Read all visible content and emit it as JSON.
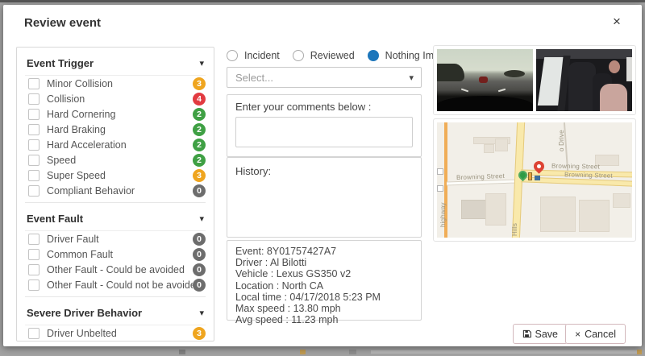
{
  "modal": {
    "title": "Review event"
  },
  "icons": {
    "close": "×",
    "caret_down": "▾",
    "select_caret": "▾",
    "cancel_x": "×"
  },
  "left_panel": {
    "sections": [
      {
        "title": "Event Trigger",
        "items": [
          {
            "label": "Minor Collision",
            "count": "3",
            "color": "amber"
          },
          {
            "label": "Collision",
            "count": "4",
            "color": "red"
          },
          {
            "label": "Hard Cornering",
            "count": "2",
            "color": "green"
          },
          {
            "label": "Hard Braking",
            "count": "2",
            "color": "green"
          },
          {
            "label": "Hard Acceleration",
            "count": "2",
            "color": "green"
          },
          {
            "label": "Speed",
            "count": "2",
            "color": "green"
          },
          {
            "label": "Super Speed",
            "count": "3",
            "color": "amber"
          },
          {
            "label": "Compliant Behavior",
            "count": "0",
            "color": "gray"
          }
        ]
      },
      {
        "title": "Event Fault",
        "items": [
          {
            "label": "Driver Fault",
            "count": "0",
            "color": "gray"
          },
          {
            "label": "Common Fault",
            "count": "0",
            "color": "gray"
          },
          {
            "label": "Other Fault - Could be avoided",
            "count": "0",
            "color": "gray"
          },
          {
            "label": "Other Fault - Could not be avoided",
            "count": "0",
            "color": "gray"
          }
        ]
      },
      {
        "title": "Severe Driver Behavior",
        "items": [
          {
            "label": "Driver Unbelted",
            "count": "3",
            "color": "amber"
          },
          {
            "label": "",
            "count": "",
            "color": "amber"
          }
        ]
      }
    ]
  },
  "review": {
    "radios": [
      {
        "label": "Incident",
        "selected": false
      },
      {
        "label": "Reviewed",
        "selected": false
      },
      {
        "label": "Nothing Important",
        "selected": true
      }
    ],
    "select_placeholder": "Select...",
    "comments_label": "Enter your comments below :",
    "history_label": "History:"
  },
  "details": {
    "lines": [
      "Event: 8Y01757427A7",
      "Driver : Al Bilotti",
      "Vehicle : Lexus GS350 v2",
      "Location : North CA",
      "Local time : 04/17/2018 5:23 PM",
      "Max speed : 13.80 mph",
      "Avg speed : 11.23 mph"
    ]
  },
  "map": {
    "labels": {
      "street_left": "Browning Street",
      "street_right_1": "Browning Street",
      "street_right_2": "Browning Street",
      "vertical_left": "highway",
      "vertical_center": "Hills",
      "vertical_right": "o Drive"
    }
  },
  "footer": {
    "save_label": "Save",
    "cancel_label": "Cancel"
  },
  "colors": {
    "badge_amber": "#efa51f",
    "badge_red": "#e23b41",
    "badge_green": "#3fa044",
    "badge_gray": "#6d6d6d",
    "radio_selected_blue": "#1d76bb",
    "map_road_yellow": "#f9e9ab",
    "map_road_orange": "#f0ad57"
  }
}
